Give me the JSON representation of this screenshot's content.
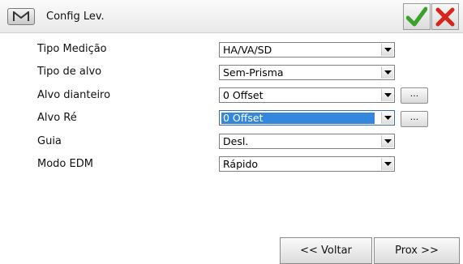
{
  "window": {
    "menu_icon": "m-logo-icon",
    "title": "Config Lev.",
    "ok_icon": "checkmark-icon",
    "cancel_icon": "close-icon",
    "ok_color": "#3aa12a",
    "cancel_color": "#d8251b"
  },
  "form": {
    "rows": [
      {
        "label": "Tipo Medição",
        "value": "HA/VA/SD"
      },
      {
        "label": "Tipo de alvo",
        "value": "Sem-Prisma"
      },
      {
        "label": "Alvo dianteiro",
        "value": "0 Offset",
        "more_button": "..."
      },
      {
        "label": "Alvo Ré",
        "value": "0 Offset",
        "more_button": "...",
        "selected": true
      },
      {
        "label": "Guia",
        "value": "Desl."
      },
      {
        "label": "Modo EDM",
        "value": "Rápido"
      }
    ]
  },
  "footer": {
    "back_label": "<< Voltar",
    "next_label": "Prox >>"
  },
  "colors": {
    "selection": "#3388dd"
  }
}
